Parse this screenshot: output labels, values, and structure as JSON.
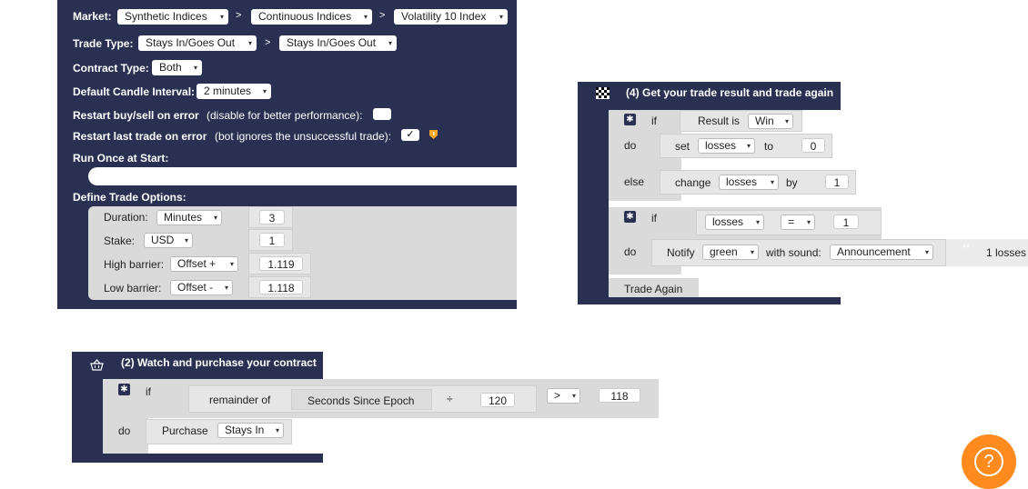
{
  "trade_params": {
    "market_label": "Market:",
    "market": "Synthetic Indices",
    "submarket": "Continuous Indices",
    "symbol": "Volatility 10 Index",
    "trade_type_label": "Trade Type:",
    "trade_type_category": "Stays In/Goes Out",
    "trade_type": "Stays In/Goes Out",
    "contract_type_label": "Contract Type:",
    "contract_type": "Both",
    "candle_interval_label": "Default Candle Interval:",
    "candle_interval": "2 minutes",
    "restart_error_label": "Restart buy/sell on error",
    "restart_error_hint": "(disable for better performance):",
    "restart_last_label": "Restart last trade on error",
    "restart_last_hint": "(bot ignores the unsuccessful trade):",
    "restart_last_check": "✓",
    "run_once_label": "Run Once at Start:",
    "define_options_label": "Define Trade Options:",
    "duration_label": "Duration:",
    "duration_unit": "Minutes",
    "duration_value": "3",
    "stake_label": "Stake:",
    "currency": "USD",
    "stake_value": "1",
    "high_barrier_label": "High barrier:",
    "high_barrier_type": "Offset +",
    "high_barrier_value": "1.119",
    "low_barrier_label": "Low barrier:",
    "low_barrier_type": "Offset -",
    "low_barrier_value": "1.118"
  },
  "after_purchase": {
    "title": "(4) Get your trade result and trade again",
    "if1": "if",
    "result_is": "Result is",
    "result_value": "Win",
    "do1": "do",
    "set": "set",
    "set_var": "losses",
    "to": "to",
    "set_value": "0",
    "else": "else",
    "change": "change",
    "change_var": "losses",
    "by": "by",
    "change_value": "1",
    "if2": "if",
    "cmp_var": "losses",
    "cmp_op": "=",
    "cmp_value": "1",
    "do2": "do",
    "notify": "Notify",
    "notify_color": "green",
    "with_sound": "with sound:",
    "sound": "Announcement",
    "quote": "“",
    "message": "1 losses",
    "trade_again": "Trade Again"
  },
  "purchase_block": {
    "title": "(2) Watch and purchase your contract",
    "if": "if",
    "remainder_of": "remainder of",
    "seconds_since_epoch": "Seconds Since Epoch",
    "divide": "÷",
    "divisor": "120",
    "cmp_op": ">",
    "cmp_value": "118",
    "do": "do",
    "purchase": "Purchase",
    "purchase_type": "Stays In"
  },
  "help": {
    "label": "?"
  },
  "colors": {
    "block_navy": "#2a3052",
    "help_orange": "#ff8a1e",
    "warning": "#f5a623"
  }
}
